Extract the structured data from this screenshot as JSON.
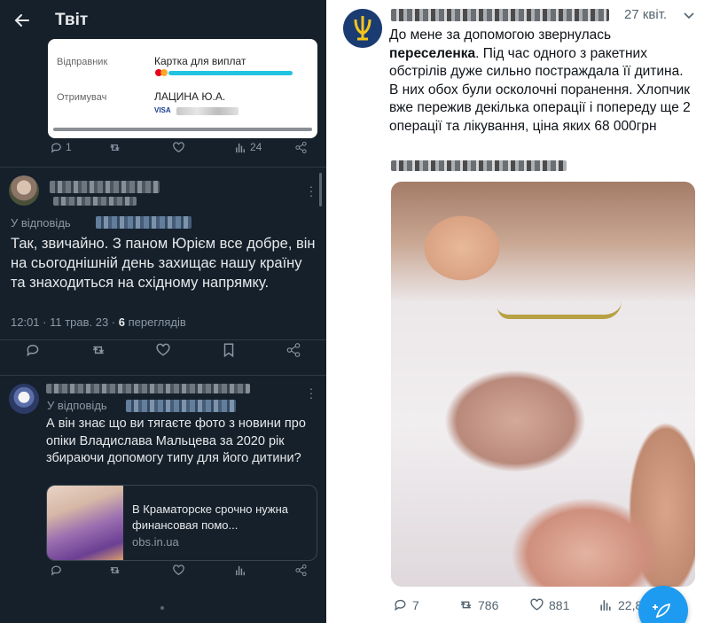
{
  "left": {
    "header": {
      "title": "Твіт"
    },
    "receipt": {
      "sender_label": "Відправник",
      "sender_value": "Картка для виплат",
      "recipient_label": "Отримувач",
      "recipient_value": "ЛАЦИНА Ю.А.",
      "card_brand": "VISA"
    },
    "tweet1_actions": {
      "replies": "1",
      "views": "24"
    },
    "reply1": {
      "reply_prefix": "У відповідь",
      "text": "Так, звичайно. З паном Юрієм все добре, він на сьогоднішній день захищає нашу країну та знаходиться на східному напрямку.",
      "time": "12:01 · 11 трав. 23 ·",
      "views_count": "6",
      "views_label": "переглядів"
    },
    "reply2": {
      "reply_prefix": "У відповідь",
      "text": "А він знає що ви тягаєте фото з новини про опіки Владислава Мальцева за 2020 рік збираючи допомогу типу для його дитини?",
      "link_title": "В Краматорске срочно нужна финансовая помо...",
      "link_domain": "obs.in.ua"
    }
  },
  "right": {
    "date": "27 квіт.",
    "text_before_bold": "До мене за допомогою звернулась ",
    "bold": "переселенка",
    "text_after_bold": ". Під час одного з ракетних обстрілів дуже сильно постраждала її дитина. В них обох були осколочні поранення. Хлопчик вже пережив декілька операції і попереду ще 2 операції та лікування, ціна яких 68 000грн",
    "stats": {
      "replies": "7",
      "retweets": "786",
      "likes": "881",
      "views": "22,8"
    }
  },
  "colors": {
    "dark_bg": "#15202b",
    "accent": "#1d9bf0",
    "muted": "#8b98a5"
  }
}
